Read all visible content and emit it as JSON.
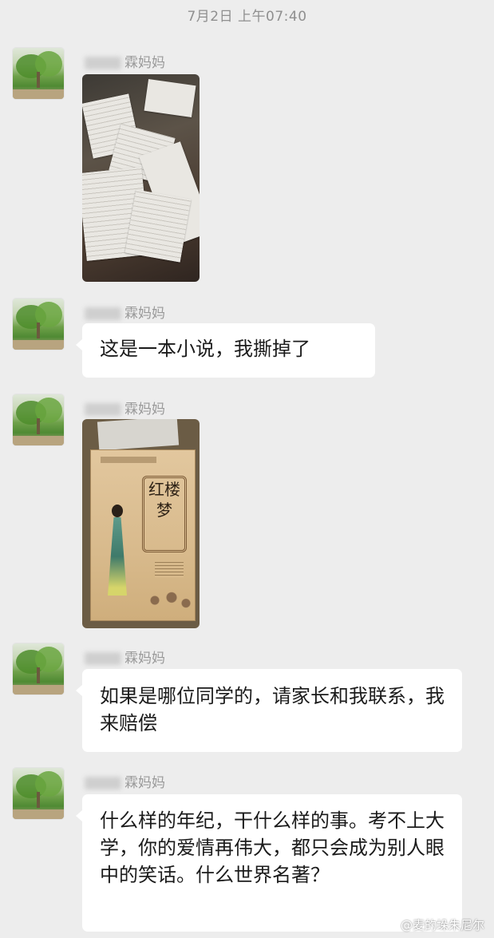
{
  "timestamp": "7月2日 上午07:40",
  "messages": [
    {
      "sender": "张嫣霖妈妈",
      "type": "image",
      "image_desc": "torn-pages-photo"
    },
    {
      "sender": "张嫣霖妈妈",
      "type": "text",
      "text": "这是一本小说，我撕掉了"
    },
    {
      "sender": "张嫣霖妈妈",
      "type": "image",
      "image_desc": "book-cover-photo"
    },
    {
      "sender": "张嫣霖妈妈",
      "type": "text",
      "text": "如果是哪位同学的，请家长和我联系，我来赔偿"
    },
    {
      "sender": "张嫣霖妈妈",
      "type": "text",
      "text": "什么样的年纪，干什么样的事。考不上大学，你的爱情再伟大，都只会成为别人眼中的笑话。什么世界名著？"
    }
  ],
  "book_title": "红楼梦",
  "watermark": "@麦的垛朱尼尔"
}
